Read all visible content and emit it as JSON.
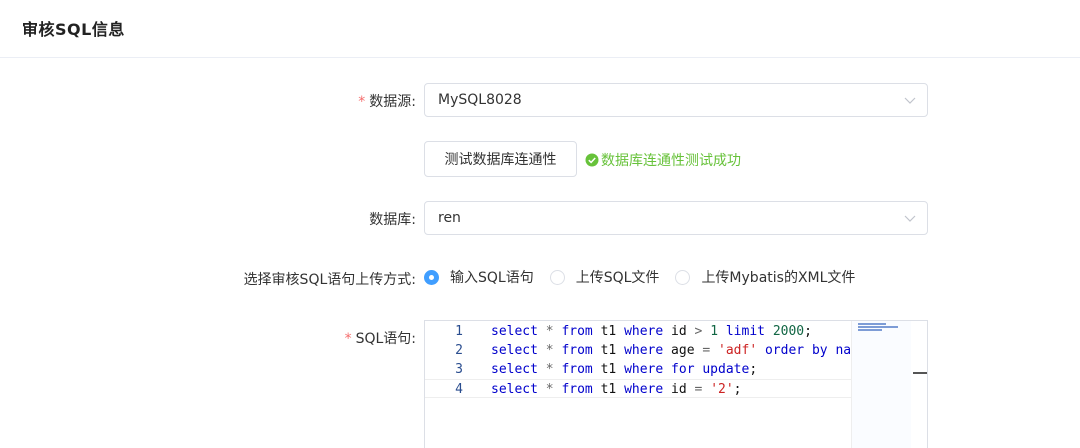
{
  "page": {
    "title": "审核SQL信息"
  },
  "form": {
    "datasource": {
      "required_mark": "*",
      "label": "数据源:",
      "value": "MySQL8028"
    },
    "test_button": {
      "label": "测试数据库连通性"
    },
    "test_status": {
      "text": "数据库连通性测试成功",
      "color": "#67c23a"
    },
    "database": {
      "label": "数据库:",
      "value": "ren"
    },
    "upload_mode": {
      "label": "选择审核SQL语句上传方式:",
      "options": [
        {
          "label": "输入SQL语句",
          "checked": true
        },
        {
          "label": "上传SQL文件",
          "checked": false
        },
        {
          "label": "上传Mybatis的XML文件",
          "checked": false
        }
      ]
    },
    "sql": {
      "required_mark": "*",
      "label": "SQL语句:",
      "lines": [
        {
          "num": "1",
          "tokens": [
            [
              "kw",
              "select"
            ],
            [
              "op",
              " * "
            ],
            [
              "kw",
              "from"
            ],
            [
              "id",
              " t1 "
            ],
            [
              "kw",
              "where"
            ],
            [
              "id",
              " id "
            ],
            [
              "op",
              ">"
            ],
            [
              "id",
              " "
            ],
            [
              "num",
              "1"
            ],
            [
              "id",
              " "
            ],
            [
              "kw",
              "limit"
            ],
            [
              "id",
              " "
            ],
            [
              "num",
              "2000"
            ],
            [
              "id",
              ";"
            ]
          ]
        },
        {
          "num": "2",
          "tokens": [
            [
              "kw",
              "select"
            ],
            [
              "op",
              " * "
            ],
            [
              "kw",
              "from"
            ],
            [
              "id",
              " t1 "
            ],
            [
              "kw",
              "where"
            ],
            [
              "id",
              " age "
            ],
            [
              "op",
              "="
            ],
            [
              "id",
              " "
            ],
            [
              "str",
              "'adf'"
            ],
            [
              "id",
              " "
            ],
            [
              "kw",
              "order by"
            ],
            [
              "id",
              " "
            ],
            [
              "kw",
              "name"
            ]
          ]
        },
        {
          "num": "3",
          "tokens": [
            [
              "kw",
              "select"
            ],
            [
              "op",
              " * "
            ],
            [
              "kw",
              "from"
            ],
            [
              "id",
              " t1 "
            ],
            [
              "kw",
              "where"
            ],
            [
              "id",
              " "
            ],
            [
              "kw",
              "for update"
            ],
            [
              "id",
              ";"
            ]
          ]
        },
        {
          "num": "4",
          "tokens": [
            [
              "kw",
              "select"
            ],
            [
              "op",
              " * "
            ],
            [
              "kw",
              "from"
            ],
            [
              "id",
              " t1 "
            ],
            [
              "kw",
              "where"
            ],
            [
              "id",
              " id "
            ],
            [
              "op",
              "="
            ],
            [
              "id",
              " "
            ],
            [
              "str",
              "'2'"
            ],
            [
              "id",
              ";"
            ]
          ]
        }
      ]
    }
  },
  "colors": {
    "primary": "#409eff",
    "required": "#f56c6c",
    "success": "#67c23a",
    "border": "#dcdfe6"
  },
  "icons": {
    "select_arrow": "chevron-down-icon",
    "status": "check-circle-icon"
  }
}
